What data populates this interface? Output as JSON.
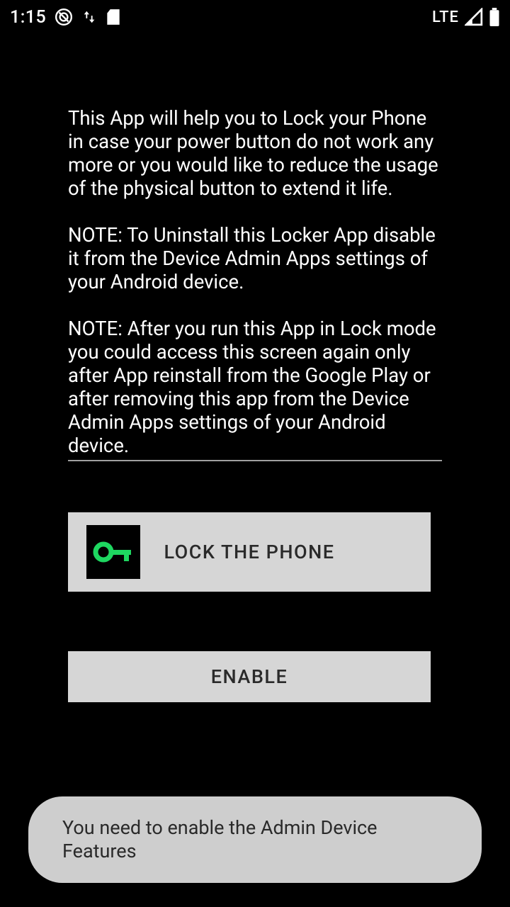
{
  "status_bar": {
    "time": "1:15",
    "network_label": "LTE"
  },
  "content": {
    "description": "This App will help you to Lock your Phone in case your power button do not work any more or you would like to reduce the usage of the physical button to extend it life.\n\nNOTE: To Uninstall this Locker App disable it from the Device Admin Apps settings of your Android device.\n\nNOTE: After you run this App in Lock mode you could access this screen again only after App reinstall from the Google Play or after removing this app from the Device Admin Apps settings of your Android device."
  },
  "buttons": {
    "lock_label": "LOCK THE PHONE",
    "enable_label": "ENABLE"
  },
  "toast": {
    "message": "You need to enable the Admin Device Features"
  },
  "colors": {
    "accent_green": "#1ED760",
    "button_bg": "#d6d6d6",
    "toast_bg": "#cecece"
  }
}
